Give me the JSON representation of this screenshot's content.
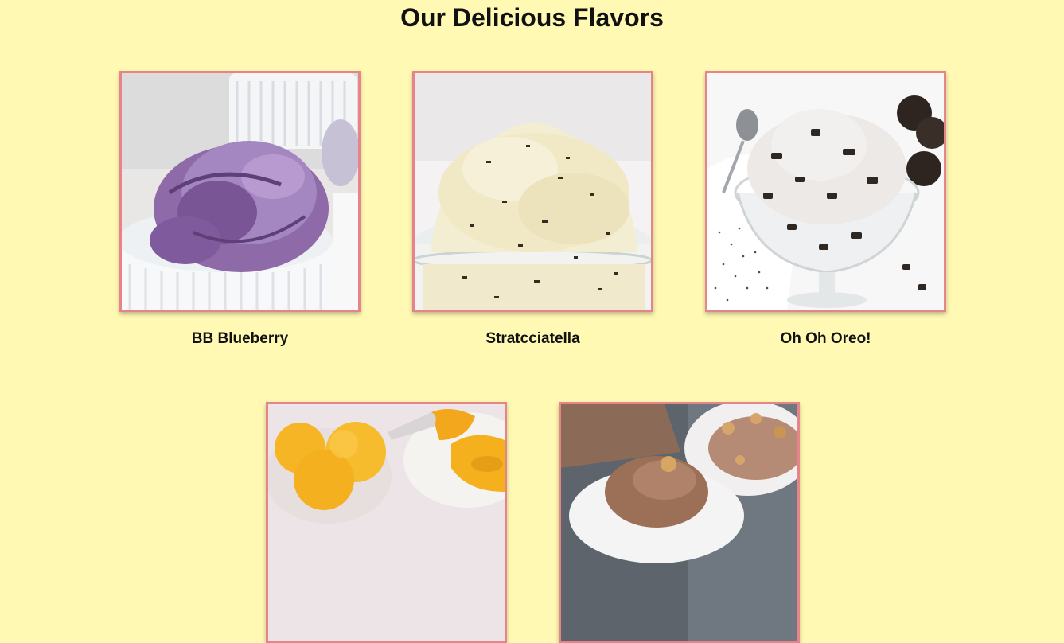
{
  "page": {
    "title": "Our Delicious Flavors",
    "background": "#fff9b3",
    "frame_color": "#e6848a"
  },
  "flavors": [
    {
      "name": "BB Blueberry",
      "image": "blueberry-ice-cream-photo"
    },
    {
      "name": "Stratcciatella",
      "image": "stracciatella-ice-cream-photo"
    },
    {
      "name": "Oh Oh Oreo!",
      "image": "oreo-ice-cream-photo"
    },
    {
      "name": "",
      "image": "mango-ice-cream-photo"
    },
    {
      "name": "",
      "image": "chocolate-hazelnut-ice-cream-photo"
    }
  ]
}
